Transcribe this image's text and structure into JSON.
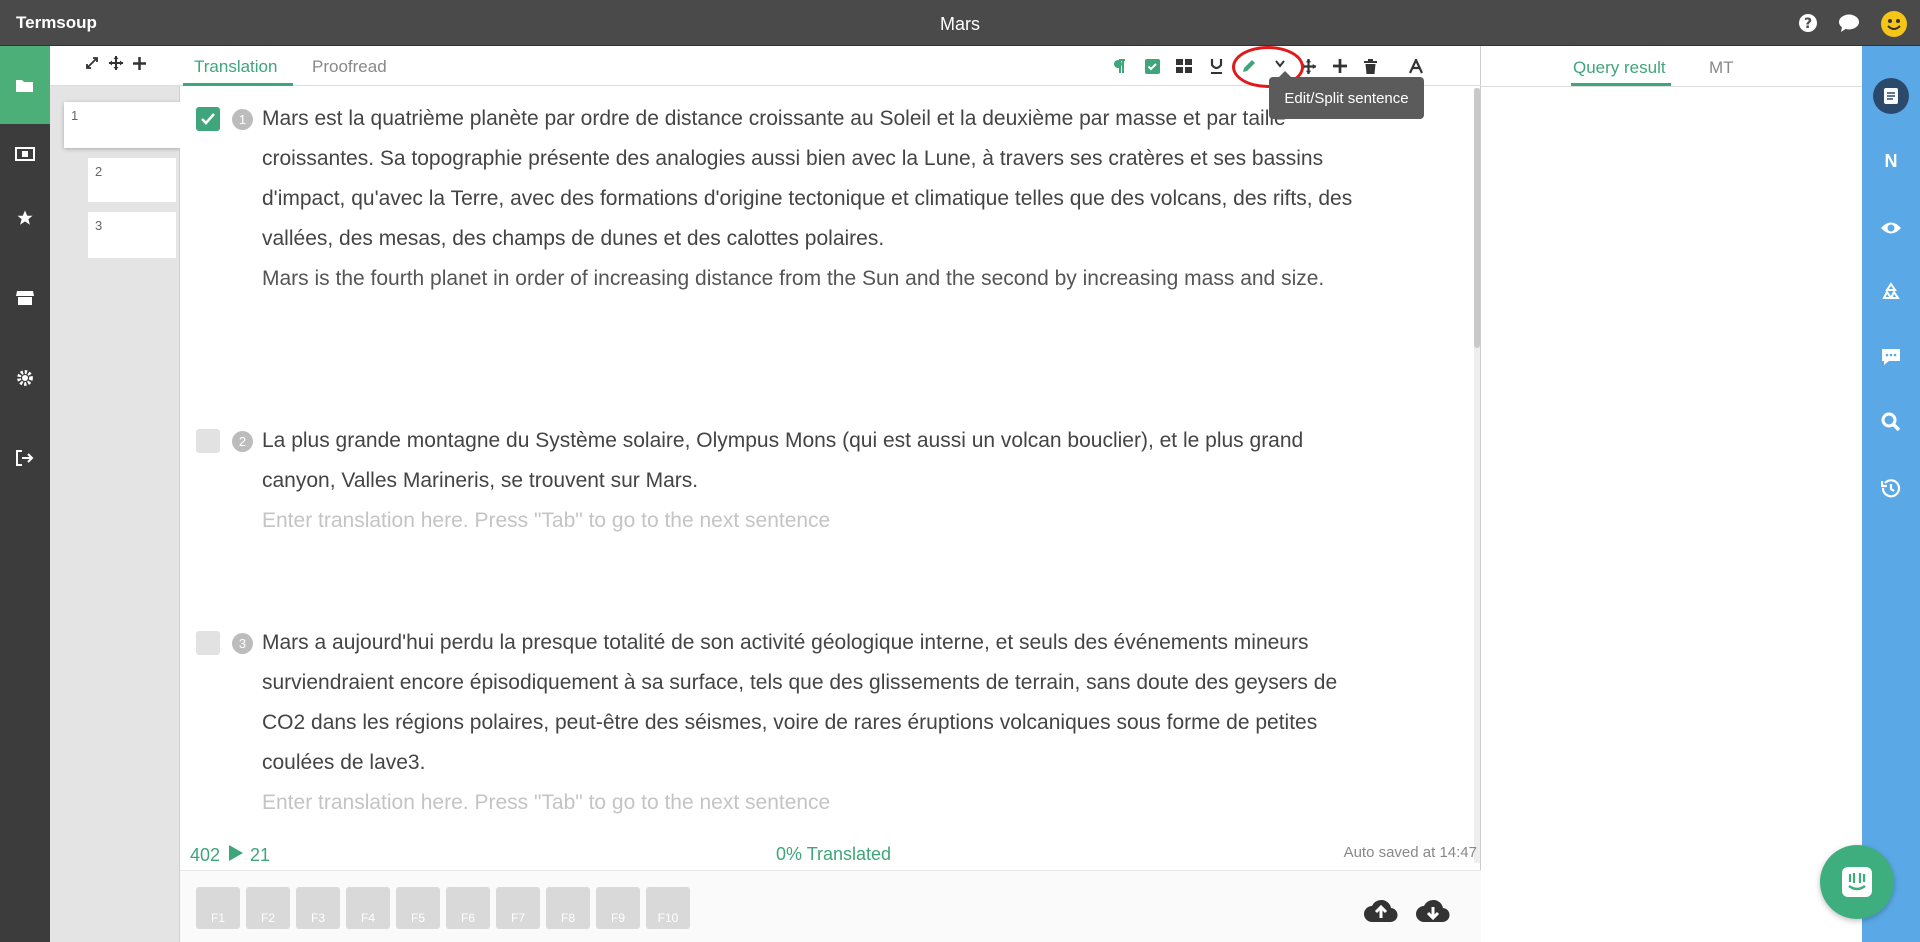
{
  "app": {
    "name": "Termsoup",
    "document_title": "Mars"
  },
  "segments": {
    "cards": [
      "1",
      "2",
      "3"
    ]
  },
  "tabs": {
    "translation": "Translation",
    "proofread": "Proofread"
  },
  "tooltip": "Edit/Split sentence",
  "sentences": [
    {
      "number": "1",
      "checked": true,
      "source": "Mars est la quatrième planète par ordre de distance croissante au Soleil et la deuxième par masse et par taille croissantes. Sa topographie présente des analogies aussi bien avec la Lune, à travers ses cratères et ses bassins d'impact, qu'avec la Terre, avec des formations d'origine tectonique et climatique telles que des volcans, des rifts, des vallées, des mesas, des champs de dunes et des calottes polaires.",
      "target": "Mars is the fourth planet in order of increasing distance from the Sun and the second by increasing mass and size."
    },
    {
      "number": "2",
      "checked": false,
      "source": "La plus grande montagne du Système solaire, Olympus Mons (qui est aussi un volcan bouclier), et le plus grand canyon, Valles Marineris, se trouvent sur Mars.",
      "placeholder": "Enter translation here. Press \"Tab\" to go to the next sentence"
    },
    {
      "number": "3",
      "checked": false,
      "source": "Mars a aujourd'hui perdu la presque totalité de son activité géologique interne, et seuls des événements mineurs surviendraient encore épisodiquement à sa surface, tels que des glissements de terrain, sans doute des geysers de CO2 dans les régions polaires, peut-être des séismes, voire de rares éruptions volcaniques sous forme de petites coulées de lave3.",
      "placeholder": "Enter translation here. Press \"Tab\" to go to the next sentence"
    }
  ],
  "status": {
    "words_total": "402",
    "words_done": "21",
    "progress": "0% Translated",
    "autosave": "Auto saved at 14:47"
  },
  "function_keys": [
    "F1",
    "F2",
    "F3",
    "F4",
    "F5",
    "F6",
    "F7",
    "F8",
    "F9",
    "F10"
  ],
  "right_panel": {
    "query_result": "Query result",
    "mt": "MT"
  },
  "right_sidebar": {
    "n_label": "N"
  },
  "colors": {
    "accent": "#3fa57a",
    "sidebar_dark": "#3c3c3c",
    "right_sidebar": "#5aa9e6",
    "topbar": "#4a4a4a",
    "highlight": "#e0191a"
  }
}
